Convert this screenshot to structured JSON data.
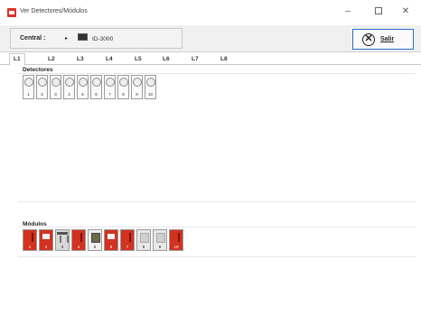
{
  "window": {
    "title": "Ver Detectores/Módulos",
    "min_glyph": "–",
    "close_glyph": "✕"
  },
  "toolbar": {
    "central_label": "Central :",
    "central_arrow": "▸",
    "central_value": "ID-3000",
    "exit_label": "Salir",
    "exit_glyph": "✕"
  },
  "tabs": [
    "L1",
    "L2",
    "L3",
    "L4",
    "L5",
    "L6",
    "L7",
    "L8"
  ],
  "detectors": {
    "title": "Detectores",
    "items": [
      "1",
      "2",
      "3",
      "4",
      "5",
      "6",
      "7",
      "8",
      "9",
      "10"
    ]
  },
  "modules": {
    "title": "Módulos",
    "items": [
      {
        "num": "1",
        "icon": "red-control-module-icon"
      },
      {
        "num": "2",
        "icon": "sounder-module-icon"
      },
      {
        "num": "3",
        "icon": "shutter-module-icon"
      },
      {
        "num": "4",
        "icon": "red-control-module-icon"
      },
      {
        "num": "5",
        "icon": "relay-module-icon"
      },
      {
        "num": "6",
        "icon": "sounder-module-icon"
      },
      {
        "num": "7",
        "icon": "red-control-module-icon"
      },
      {
        "num": "8",
        "icon": "input-module-icon"
      },
      {
        "num": "9",
        "icon": "input-module-icon"
      },
      {
        "num": "10",
        "icon": "red-control-module-icon"
      }
    ]
  }
}
